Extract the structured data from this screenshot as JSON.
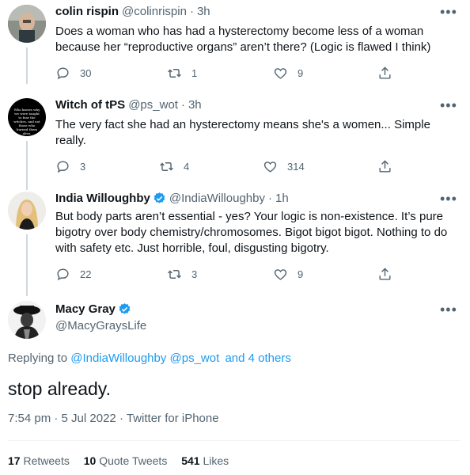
{
  "replies": [
    {
      "name": "colin rispin",
      "handle": "@colinrispin",
      "time": "3h",
      "text": "Does a woman who has had a hysterectomy become less of a woman because her “reproductive organs” aren’t there? (Logic is flawed I think)",
      "replies": "30",
      "retweets": "1",
      "likes": "9"
    },
    {
      "name": "Witch of tPS",
      "handle": "@ps_wot",
      "time": "3h",
      "text": "The very fact she had an hysterectomy means she's a women... Simple really.",
      "replies": "3",
      "retweets": "4",
      "likes": "314"
    },
    {
      "name": "India Willoughby",
      "handle": "@IndiaWilloughby",
      "time": "1h",
      "text": "But body parts aren’t essential - yes?  Your logic is non-existence.  It’s pure bigotry over body chemistry/chromosomes. Bigot bigot bigot. Nothing to do with safety etc. Just horrible, foul, disgusting bigotry.",
      "replies": "22",
      "retweets": "3",
      "likes": "9"
    }
  ],
  "main": {
    "name": "Macy Gray",
    "handle": "@MacyGraysLife",
    "replying_label": "Replying to",
    "replying_to": [
      "@IndiaWilloughby",
      "@ps_wot"
    ],
    "others": "and 4 others",
    "text": "stop already.",
    "time": "7:54 pm",
    "date": "5 Jul 2022",
    "source": "Twitter for iPhone",
    "retweets_count": "17",
    "retweets_label": "Retweets",
    "quotes_count": "10",
    "quotes_label": "Quote Tweets",
    "likes_count": "541",
    "likes_label": "Likes"
  },
  "avatar_text": "Who knows why we were taught to fear the witches, and not those who burned them alive.",
  "colors": {
    "accent": "#1d9bf0",
    "secondary": "#536471",
    "primary_text": "#0f1419"
  },
  "icons": [
    "reply-icon",
    "retweet-icon",
    "like-icon",
    "share-icon",
    "more-icon",
    "verified-icon"
  ]
}
